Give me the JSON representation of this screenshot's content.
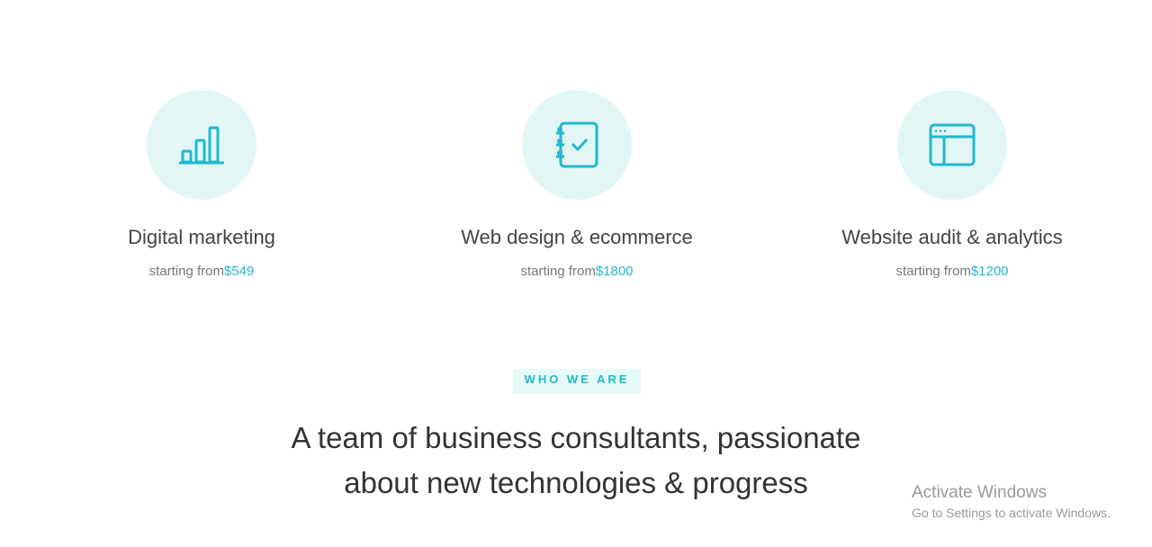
{
  "services": [
    {
      "icon": "bar-chart-icon",
      "title": "Digital marketing",
      "price_prefix": "starting from",
      "price": "$549"
    },
    {
      "icon": "checklist-notebook-icon",
      "title": "Web design & ecommerce",
      "price_prefix": "starting from",
      "price": "$1800"
    },
    {
      "icon": "browser-window-icon",
      "title": "Website audit & analytics",
      "price_prefix": "starting from",
      "price": "$1200"
    }
  ],
  "about": {
    "tag": "WHO WE ARE",
    "headline_line1": "A team of business consultants, passionate",
    "headline_line2": "about new technologies & progress"
  },
  "watermark": {
    "title": "Activate Windows",
    "subtitle": "Go to Settings to activate Windows."
  },
  "colors": {
    "accent": "#22b8cf",
    "icon_bg": "#e3f6f6",
    "tag_bg": "#e6fafa"
  }
}
